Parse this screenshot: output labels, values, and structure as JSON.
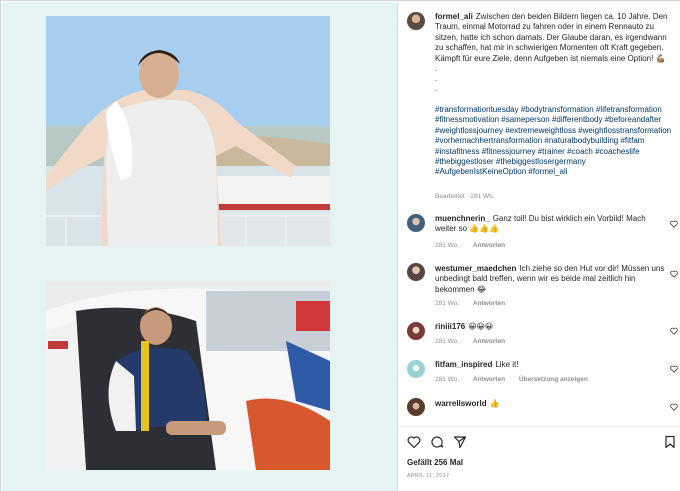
{
  "post": {
    "username": "formel_ali",
    "caption": "Zwischen den beiden Bildern liegen ca. 10 Jahre. Den Traum, einmal Motorrad zu fahren oder in einem Rennauto zu sitzen, hatte ich schon damals. Der Glaube daran, es irgendwann zu schaffen, hat mir in schwierigen Momenten oft Kraft gegeben. Kämpft für eure Ziele, denn Aufgeben ist niemals eine Option! 💪🏽",
    "dots": [
      ".",
      ".",
      "."
    ],
    "hashtags": "#transformationtuesday #bodytransformation #lifetransformation #fitnessmotivation #sameperson #differentbody #beforeandafter #weightlossjourney #extremeweightloss #weightlosstransformation #vorhernachhertransformation #naturalbodybuilding #fitfam #instafitness #fitnessjourney #trainer #coach #coacheslife #thebiggestloser #thebiggestlosergermany #AufgebenIstKeineOption #formel_ali",
    "edited": "Bearbeitet · 281 Wo."
  },
  "comments": [
    {
      "user": "muenchnerin_",
      "text": "Ganz toll! Du bist wirklich ein Vorbild! Mach weiter so 👍👍👍",
      "time": "281 Wo.",
      "reply": "Antworten",
      "translate": ""
    },
    {
      "user": "westumer_maedchen",
      "text": "Ich ziehe so den Hut vor dir! Müssen uns unbedingt bald treffen, wenn wir es beide mal zeitlich hin bekommen 😂",
      "time": "281 Wo.",
      "reply": "Antworten",
      "translate": ""
    },
    {
      "user": "riniii176",
      "text": "😀😀😀",
      "time": "281 Wo.",
      "reply": "Antworten",
      "translate": ""
    },
    {
      "user": "fitfam_inspired",
      "text": "Like it!",
      "time": "281 Wo.",
      "reply": "Antworten",
      "translate": "Übersetzung anzeigen"
    },
    {
      "user": "warrellsworld",
      "text": "👍",
      "time": "",
      "reply": "",
      "translate": ""
    }
  ],
  "footer": {
    "likes": "Gefällt 256 Mal",
    "date": "APRIL 11, 2017"
  },
  "icons": {
    "like": "heart-icon",
    "comment": "comment-icon",
    "share": "paper-plane-icon",
    "save": "bookmark-icon"
  },
  "colors": {
    "link": "#00376b",
    "muted": "#8e8e8e",
    "media_bg": "#e6f3f3"
  }
}
